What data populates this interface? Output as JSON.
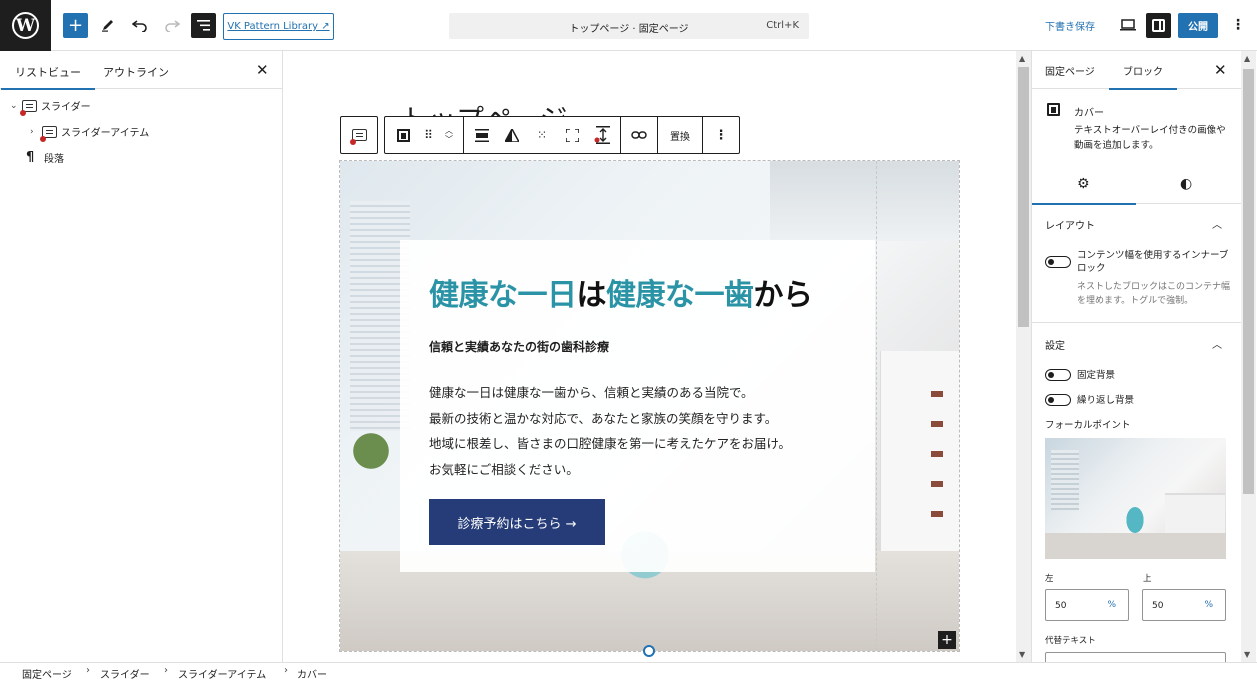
{
  "header": {
    "logo": "W",
    "vk_pattern_library": "VK Pattern Library ↗",
    "doc_title": "トップページ · 固定ページ",
    "shortcut": "Ctrl+K",
    "draft_label": "下書き保存",
    "publish_label": "公開",
    "icons": {
      "add": "plus-icon",
      "edit": "pencil-icon",
      "undo": "undo-icon",
      "redo": "redo-icon",
      "list": "list-view-icon",
      "preview": "desktop-preview-icon",
      "settings": "sidebar-toggle-icon",
      "more": "more-vertical-icon"
    }
  },
  "left_panel": {
    "tab_list": "リストビュー",
    "tab_outline": "アウトライン",
    "items": [
      {
        "label": "スライダー",
        "chevron": "⌄"
      },
      {
        "label": "スライダーアイテム",
        "chevron": "›"
      },
      {
        "label": "段落",
        "icon_glyph": "¶"
      }
    ]
  },
  "canvas": {
    "page_title": "トップページ",
    "toolbar_replace": "置換",
    "cover": {
      "heading_parts": [
        {
          "text": "健康な一日",
          "color": "teal"
        },
        {
          "text": "は",
          "color": "black"
        },
        {
          "text": "健康な一歯",
          "color": "teal"
        },
        {
          "text": "から",
          "color": "black"
        }
      ],
      "subheading": "信頼と実績あなたの街の歯科診療",
      "body": [
        "健康な一日は健康な一歯から、信頼と実績のある当院で。",
        "最新の技術と温かな対応で、あなたと家族の笑顔を守ります。",
        "地域に根差し、皆さまの口腔健康を第一に考えたケアをお届け。",
        "お気軽にご相談ください。"
      ],
      "cta": "診療予約はこちら →"
    }
  },
  "right_panel": {
    "tab_page": "固定ページ",
    "tab_block": "ブロック",
    "block_name": "カバー",
    "block_desc": "テキストオーバーレイ付きの画像や動画を追加します。",
    "layout_title": "レイアウト",
    "inner_toggle_label": "コンテンツ幅を使用するインナーブロック",
    "inner_toggle_help": "ネストしたブロックはこのコンテナ幅を埋めます。トグルで強制。",
    "settings_title": "設定",
    "fixed_bg": "固定背景",
    "repeat_bg": "繰り返し背景",
    "focal_label": "フォーカルポイント",
    "left_label": "左",
    "top_label": "上",
    "left_value": "50",
    "top_value": "50",
    "unit": "%",
    "alt_label": "代替テキスト"
  },
  "footer": {
    "crumbs": [
      "固定ページ",
      "スライダー",
      "スライダーアイテム",
      "カバー"
    ]
  },
  "colors": {
    "accent": "#2271b1",
    "teal_heading": "#2a93a6",
    "cta_bg": "#253c78",
    "wp_dark": "#1e1e1e"
  }
}
